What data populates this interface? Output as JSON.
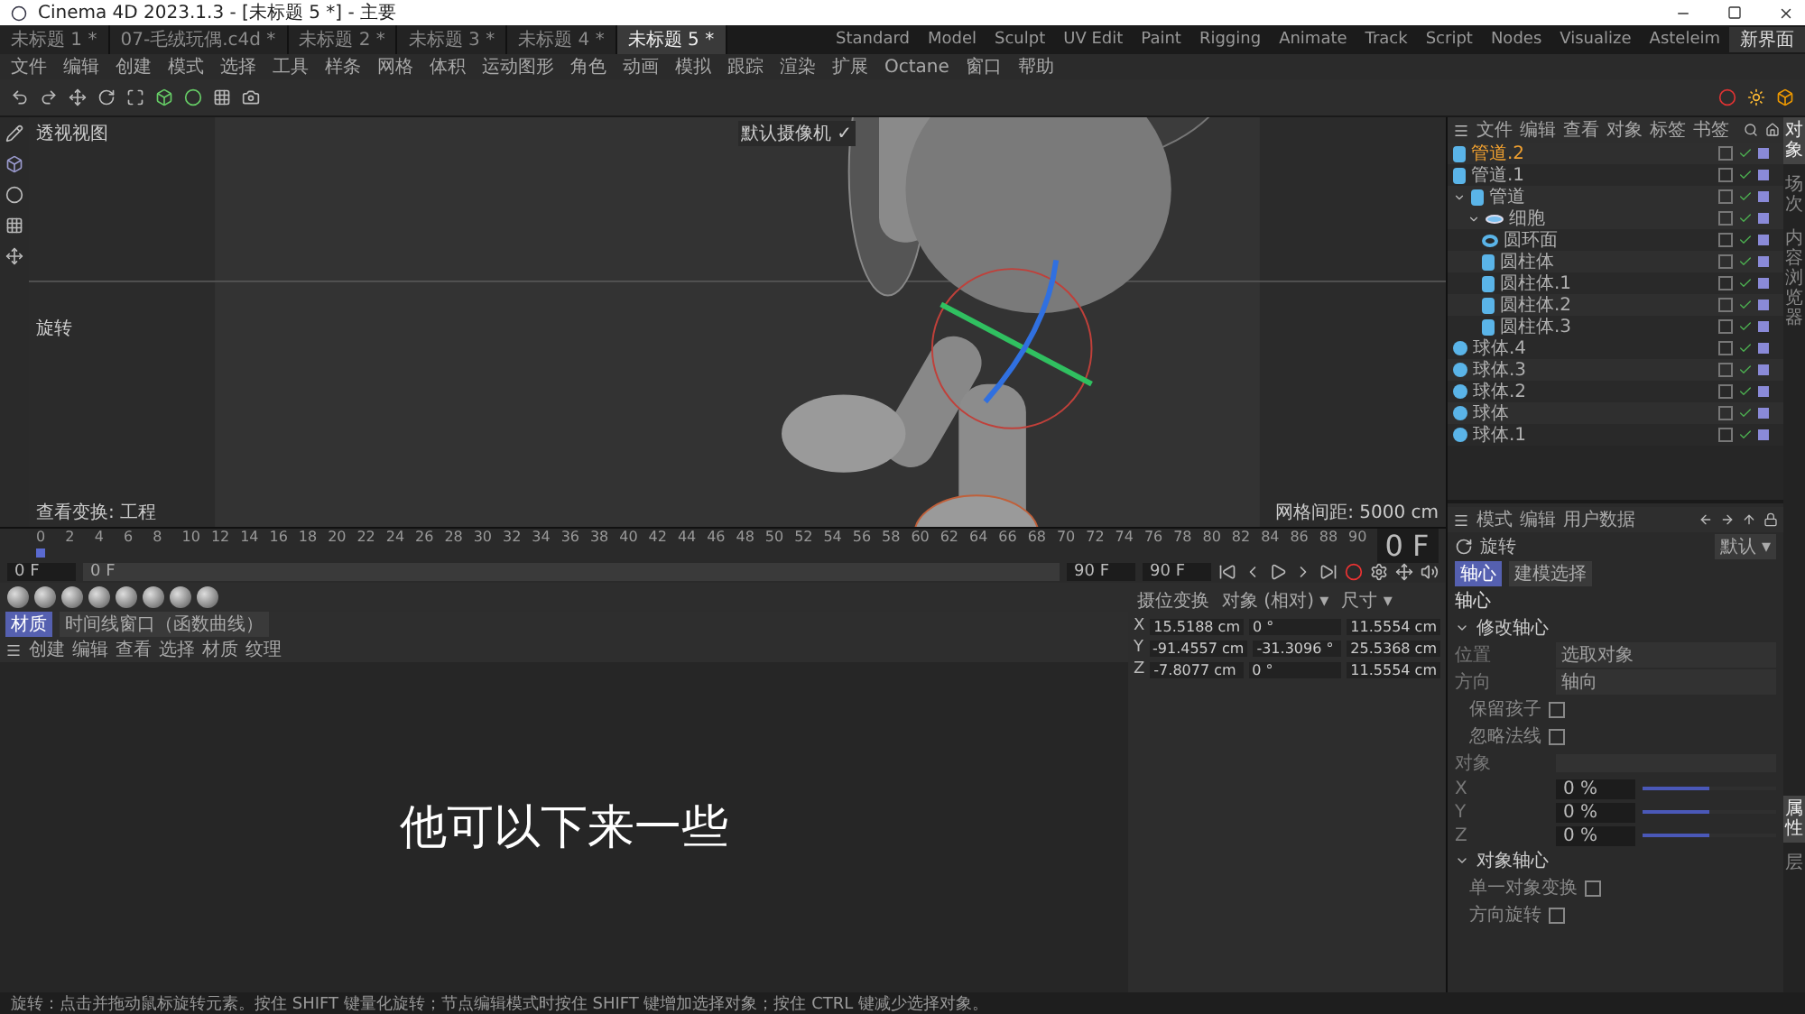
{
  "window": {
    "title": "Cinema 4D 2023.1.3 - [未标题 5 *] - 主要"
  },
  "doc_tabs": [
    {
      "label": "未标题 1 *",
      "selected": false
    },
    {
      "label": "07-毛绒玩偶.c4d *",
      "selected": false
    },
    {
      "label": "未标题 2 *",
      "selected": false
    },
    {
      "label": "未标题 3 *",
      "selected": false
    },
    {
      "label": "未标题 4 *",
      "selected": false
    },
    {
      "label": "未标题 5 *",
      "selected": true
    }
  ],
  "layouts": [
    {
      "label": "Standard",
      "selected": false
    },
    {
      "label": "Model",
      "selected": false
    },
    {
      "label": "Sculpt",
      "selected": false
    },
    {
      "label": "UV Edit",
      "selected": false
    },
    {
      "label": "Paint",
      "selected": false
    },
    {
      "label": "Rigging",
      "selected": false
    },
    {
      "label": "Animate",
      "selected": false
    },
    {
      "label": "Track",
      "selected": false
    },
    {
      "label": "Script",
      "selected": false
    },
    {
      "label": "Nodes",
      "selected": false
    },
    {
      "label": "Visualize",
      "selected": false
    },
    {
      "label": "Asteleim",
      "selected": false
    }
  ],
  "new_layout": "新界面",
  "menu": [
    "文件",
    "编辑",
    "创建",
    "模式",
    "选择",
    "工具",
    "样条",
    "网格",
    "体积",
    "运动图形",
    "角色",
    "动画",
    "模拟",
    "跟踪",
    "渲染",
    "扩展",
    "Octane",
    "窗口",
    "帮助"
  ],
  "viewport": {
    "name": "透视视图",
    "camera": "默认摄像机 ✓",
    "tool": "旋转",
    "view_transform": "查看变换: 工程",
    "grid": "网格间距: 5000 cm",
    "subtitle": "他可以下来一些"
  },
  "timeline": {
    "ticks": [
      "0",
      "2",
      "4",
      "6",
      "8",
      "10",
      "12",
      "14",
      "16",
      "18",
      "20",
      "22",
      "24",
      "26",
      "28",
      "30",
      "32",
      "34",
      "36",
      "38",
      "40",
      "42",
      "44",
      "46",
      "48",
      "50",
      "52",
      "54",
      "56",
      "58",
      "60",
      "62",
      "64",
      "66",
      "68",
      "70",
      "72",
      "74",
      "76",
      "78",
      "80",
      "82",
      "84",
      "86",
      "88",
      "90"
    ],
    "level": 0,
    "current": "0 F",
    "start": "0 F",
    "range_start": "0 F",
    "range_end": "90 F",
    "end": "90 F"
  },
  "materials": {
    "tabs": [
      {
        "label": "材质",
        "selected": true
      },
      {
        "label": "时间线窗口（函数曲线）",
        "selected": false
      }
    ],
    "menu": [
      "创建",
      "编辑",
      "查看",
      "选择",
      "材质",
      "纹理"
    ]
  },
  "coordinates": {
    "modes": [
      "摄位变换",
      "对象 (相对) ▾",
      "尺寸 ▾"
    ],
    "rows": [
      {
        "axis": "X",
        "position": "15.5188 cm",
        "rotation": "0 °",
        "size": "11.5554 cm"
      },
      {
        "axis": "Y",
        "position": "-91.4557 cm",
        "rotation": "-31.3096 °",
        "size": "25.5368 cm"
      },
      {
        "axis": "Z",
        "position": "-7.8077 cm",
        "rotation": "0 °",
        "size": "11.5554 cm"
      }
    ]
  },
  "objects": {
    "menu": [
      "文件",
      "编辑",
      "查看",
      "对象",
      "标签",
      "书签"
    ],
    "items": [
      {
        "name": "管道.2",
        "kind": "cylinder",
        "selected": true
      },
      {
        "name": "管道.1",
        "kind": "cylinder",
        "selected": false
      },
      {
        "name": "管道",
        "kind": "cylinder",
        "selected": false,
        "expanded": true,
        "children": [
          {
            "name": "细胞",
            "kind": "null",
            "selected": false,
            "expanded": true,
            "children": [
              {
                "name": "圆环面",
                "kind": "torus",
                "selected": false
              },
              {
                "name": "圆柱体",
                "kind": "cylinder",
                "selected": false
              },
              {
                "name": "圆柱体.1",
                "kind": "cylinder",
                "selected": false
              },
              {
                "name": "圆柱体.2",
                "kind": "cylinder",
                "selected": false
              },
              {
                "name": "圆柱体.3",
                "kind": "cylinder",
                "selected": false
              }
            ]
          }
        ]
      },
      {
        "name": "球体.4",
        "kind": "sphere",
        "selected": false
      },
      {
        "name": "球体.3",
        "kind": "sphere",
        "selected": false
      },
      {
        "name": "球体.2",
        "kind": "sphere",
        "selected": false
      },
      {
        "name": "球体",
        "kind": "sphere",
        "selected": false
      },
      {
        "name": "球体.1",
        "kind": "sphere",
        "selected": false
      }
    ]
  },
  "side_tabs_top": [
    {
      "label": "对象",
      "selected": true
    },
    {
      "label": "场次",
      "selected": false
    },
    {
      "label": "内容浏览器",
      "selected": false
    }
  ],
  "side_tabs_bottom": [
    {
      "label": "属性",
      "selected": true
    },
    {
      "label": "层",
      "selected": false
    }
  ],
  "attributes": {
    "menu": [
      "模式",
      "编辑",
      "用户数据"
    ],
    "tool": "旋转",
    "preset": "默认 ▾",
    "tabs": [
      {
        "label": "轴心",
        "selected": true
      },
      {
        "label": "建模选择",
        "selected": false
      }
    ],
    "heading": "轴心",
    "sections": [
      {
        "title": "修改轴心",
        "expanded": true,
        "rows": [
          {
            "kind": "select",
            "label": "位置",
            "value": "选取对象"
          },
          {
            "kind": "select",
            "label": "方向",
            "value": "轴向"
          },
          {
            "kind": "check",
            "label": "保留孩子",
            "checked": false
          },
          {
            "kind": "check",
            "label": "忽略法线",
            "checked": false
          },
          {
            "kind": "link",
            "label": "对象"
          },
          {
            "kind": "slider",
            "label": "X",
            "value": "0 %",
            "level": 0.5
          },
          {
            "kind": "slider",
            "label": "Y",
            "value": "0 %",
            "level": 0.5
          },
          {
            "kind": "slider",
            "label": "Z",
            "value": "0 %",
            "level": 0.5
          }
        ]
      },
      {
        "title": "对象轴心",
        "expanded": true,
        "rows": [
          {
            "kind": "check",
            "label": "单一对象变换",
            "checked": false
          },
          {
            "kind": "check",
            "label": "方向旋转",
            "checked": false
          }
        ]
      }
    ]
  },
  "status": "旋转：点击并拖动鼠标旋转元素。按住 SHIFT 键量化旋转；节点编辑模式时按住 SHIFT 键增加选择对象；按住 CTRL 键减少选择对象。"
}
